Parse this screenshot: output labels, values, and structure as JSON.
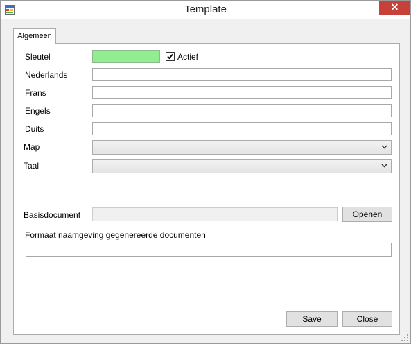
{
  "window": {
    "title": "Template"
  },
  "titlebar": {
    "close_glyph": "✕"
  },
  "tabs": [
    {
      "label": "Algemeen",
      "selected": true
    }
  ],
  "form": {
    "sleutel": {
      "label": "Sleutel",
      "value": "",
      "color": "#90ee90"
    },
    "actief": {
      "label": "Actief",
      "checked": true
    },
    "nederlands": {
      "label": "Nederlands",
      "value": ""
    },
    "frans": {
      "label": "Frans",
      "value": ""
    },
    "engels": {
      "label": "Engels",
      "value": ""
    },
    "duits": {
      "label": "Duits",
      "value": ""
    },
    "map": {
      "label": "Map",
      "selected": ""
    },
    "taal": {
      "label": "Taal",
      "selected": ""
    },
    "basisdocument": {
      "label": "Basisdocument",
      "value": "",
      "open_button": "Openen"
    },
    "naamformaat": {
      "label": "Formaat naamgeving gegenereerde documenten",
      "value": ""
    }
  },
  "footer": {
    "save_label": "Save",
    "close_label": "Close"
  },
  "icons": {
    "app": "form-icon",
    "close": "close-icon",
    "dropdown": "chevron-down-icon",
    "check": "check-icon",
    "grip": "resize-grip-icon"
  }
}
